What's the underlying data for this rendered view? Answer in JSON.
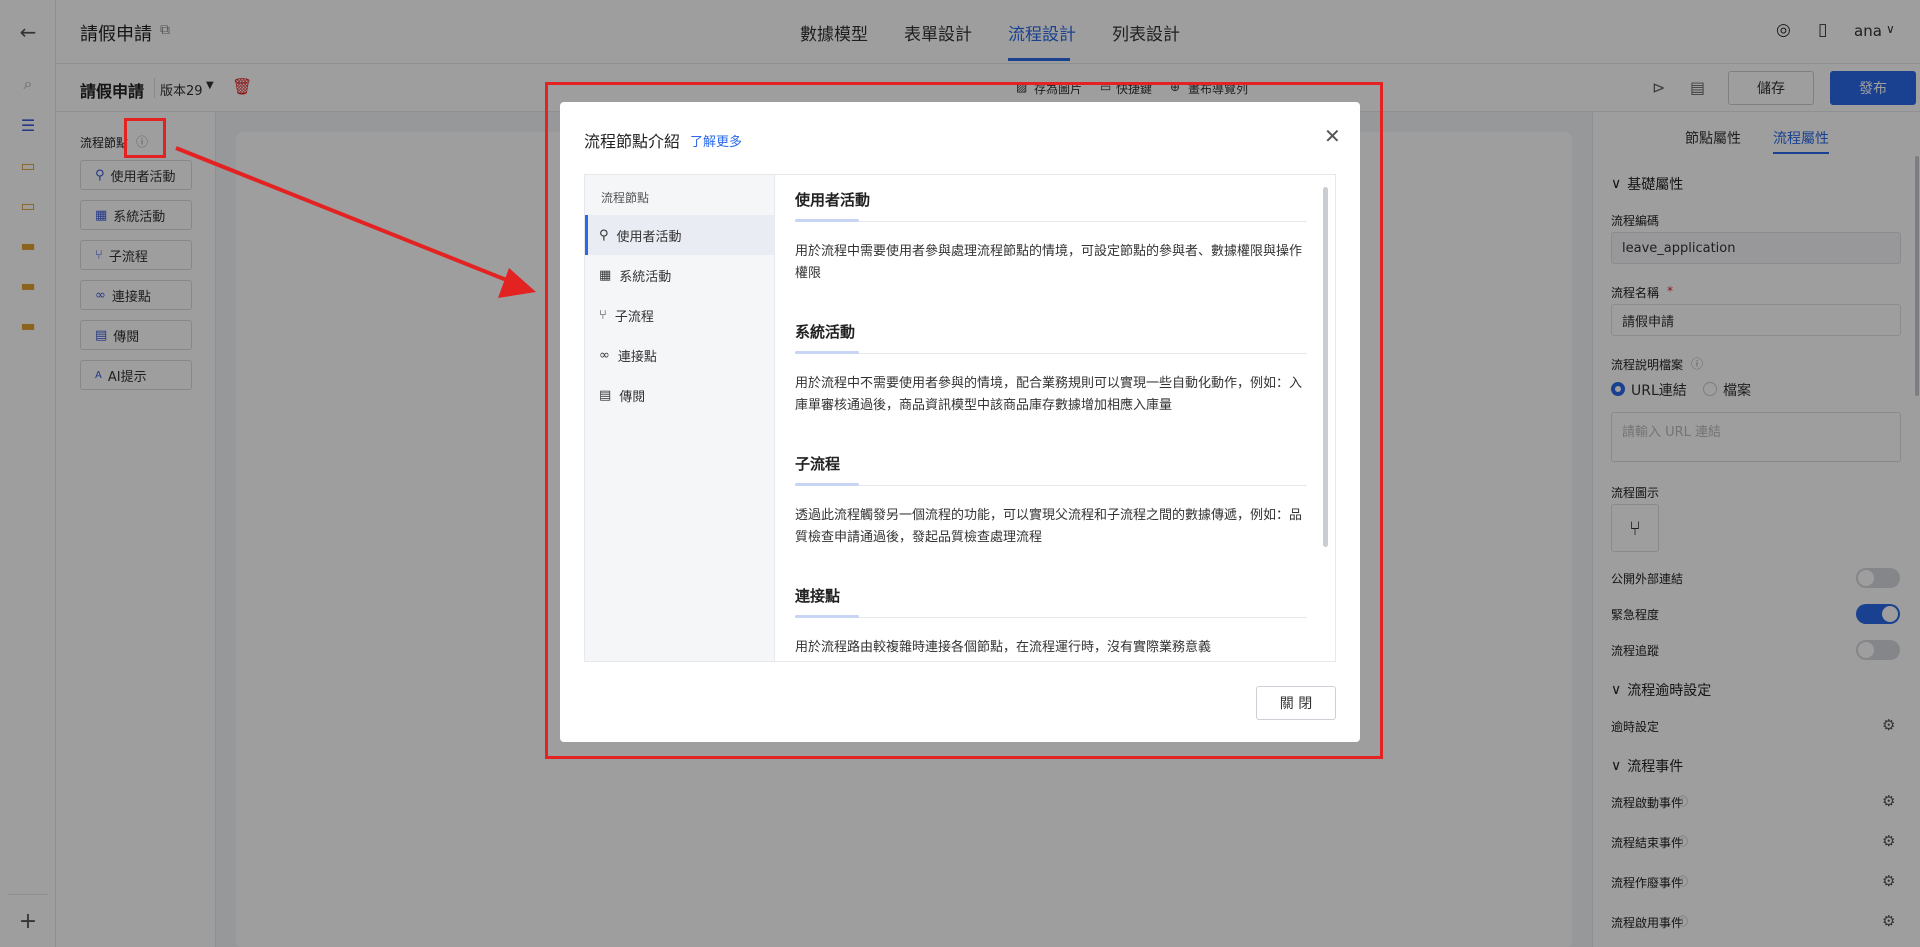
{
  "app": {
    "title": "請假申請",
    "tabs": [
      {
        "label": "數據模型",
        "active": false
      },
      {
        "label": "表單設計",
        "active": false
      },
      {
        "label": "流程設計",
        "active": true
      },
      {
        "label": "列表設計",
        "active": false
      }
    ],
    "user": "ana"
  },
  "toolbar": {
    "form_name": "請假申請",
    "version": "版本29",
    "actions": [
      "存為圖片",
      "快捷鍵",
      "畫布導覽列"
    ],
    "save_label": "儲存",
    "publish_label": "發布"
  },
  "node_panel": {
    "title": "流程節點",
    "items": [
      {
        "label": "使用者活動",
        "icon": "user-icon"
      },
      {
        "label": "系統活動",
        "icon": "grid-icon"
      },
      {
        "label": "子流程",
        "icon": "subflow-icon"
      },
      {
        "label": "連接點",
        "icon": "link-icon"
      },
      {
        "label": "傳閱",
        "icon": "circulate-icon"
      },
      {
        "label": "AI提示",
        "icon": "ai-icon"
      }
    ]
  },
  "right_panel": {
    "tabs": [
      {
        "label": "節點屬性",
        "active": false
      },
      {
        "label": "流程屬性",
        "active": true
      }
    ],
    "basic_section": "基礎屬性",
    "code_label": "流程編碼",
    "code_value": "leave_application",
    "name_label": "流程名稱",
    "name_value": "請假申請",
    "doc_label": "流程說明檔案",
    "doc_options": [
      "URL連結",
      "檔案"
    ],
    "url_placeholder": "請輸入 URL 連結",
    "diagram_label": "流程圖示",
    "toggles": [
      {
        "label": "公開外部連結",
        "on": false
      },
      {
        "label": "緊急程度",
        "on": true
      },
      {
        "label": "流程追蹤",
        "on": false
      }
    ],
    "timeout_section": "流程逾時設定",
    "timeout_label": "逾時設定",
    "event_section": "流程事件",
    "events": [
      "流程啟動事件",
      "流程結束事件",
      "流程作廢事件",
      "流程啟用事件"
    ]
  },
  "modal": {
    "title": "流程節點介紹",
    "learn_more": "了解更多",
    "side_title": "流程節點",
    "side_items": [
      {
        "label": "使用者活動",
        "icon": "user-icon",
        "active": true
      },
      {
        "label": "系統活動",
        "icon": "grid-icon",
        "active": false
      },
      {
        "label": "子流程",
        "icon": "subflow-icon",
        "active": false
      },
      {
        "label": "連接點",
        "icon": "link-icon",
        "active": false
      },
      {
        "label": "傳閱",
        "icon": "circulate-icon",
        "active": false
      }
    ],
    "sections": [
      {
        "title": "使用者活動",
        "desc": "用於流程中需要使用者參與處理流程節點的情境，可設定節點的參與者、數據權限與操作權限"
      },
      {
        "title": "系統活動",
        "desc": "用於流程中不需要使用者參與的情境，配合業務規則可以實現一些自動化動作，例如：入庫單審核通過後，商品資訊模型中該商品庫存數據增加相應入庫量"
      },
      {
        "title": "子流程",
        "desc": "透過此流程觸發另一個流程的功能，可以實現父流程和子流程之間的數據傳遞，例如：品質檢查申請通過後，發起品質檢查處理流程"
      },
      {
        "title": "連接點",
        "desc": "用於流程路由較複雜時連接各個節點，在流程運行時，沒有實際業務意義"
      }
    ],
    "close_label": "關 閉"
  },
  "colors": {
    "accent": "#2a6ae9",
    "annotation": "#e32222"
  }
}
